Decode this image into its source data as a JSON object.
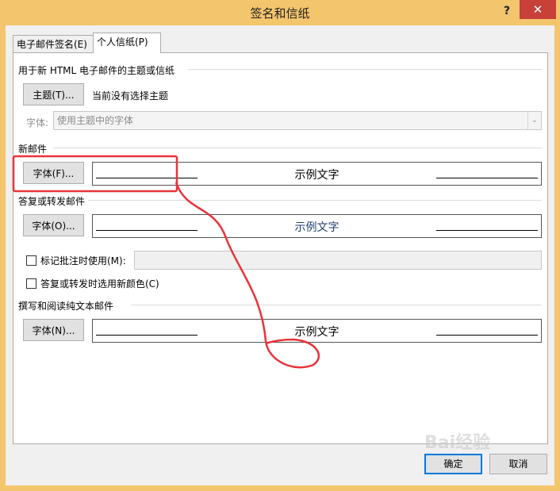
{
  "window": {
    "title": "签名和信纸",
    "help_label": "?",
    "close_label": "✕"
  },
  "tabs": [
    {
      "label": "电子邮件签名(E)",
      "active": false
    },
    {
      "label": "个人信纸(P)",
      "active": true
    }
  ],
  "stationery": {
    "section_label": "用于新 HTML 电子邮件的主题或信纸",
    "theme_button": "主题(T)...",
    "theme_status": "当前没有选择主题",
    "font_label": "字体:",
    "font_dropdown_value": "使用主题中的字体"
  },
  "new_mail": {
    "section_label": "新邮件",
    "font_button": "字体(F)...",
    "sample_text": "示例文字",
    "sample_color": "#000000"
  },
  "reply_forward": {
    "section_label": "答复或转发邮件",
    "font_button": "字体(O)...",
    "sample_text": "示例文字",
    "sample_color": "#1f3f6e",
    "mark_comments_label": "标记批注时使用(M):",
    "mark_comments_checked": false,
    "pick_new_colors_label": "答复或转发时选用新颜色(C)",
    "pick_new_colors_checked": false
  },
  "plain_text": {
    "section_label": "撰写和阅读纯文本邮件",
    "font_button": "字体(N)...",
    "sample_text": "示例文字",
    "sample_color": "#000000"
  },
  "footer": {
    "ok_label": "确定",
    "cancel_label": "取消"
  },
  "watermark": "Bai经验",
  "colors": {
    "title_bar": "#f3c56d",
    "close_button": "#c7403a",
    "annotation": "#e8333a"
  }
}
